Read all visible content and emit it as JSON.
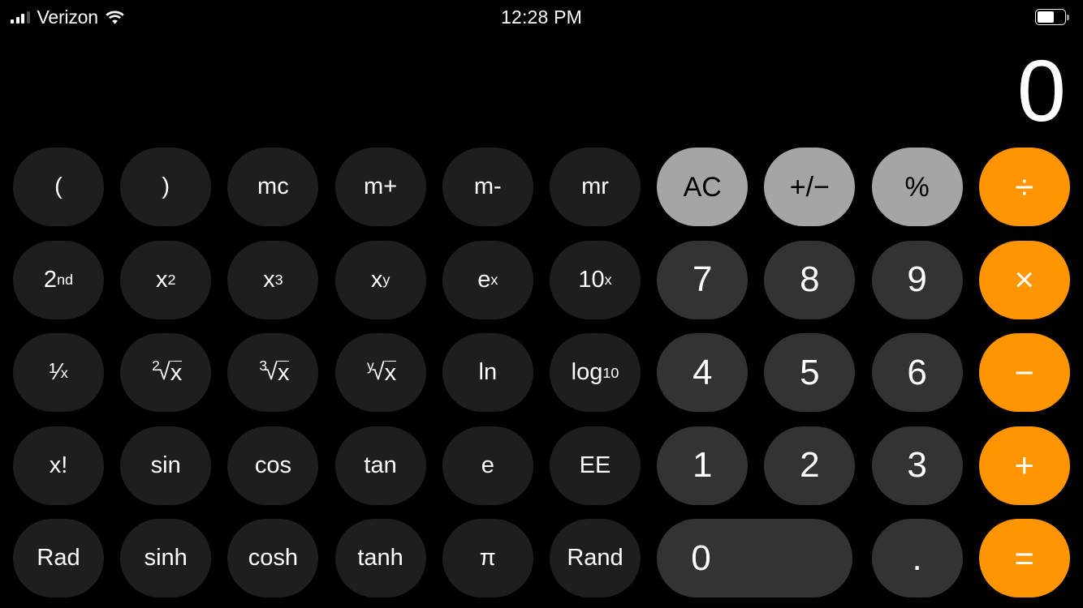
{
  "status_bar": {
    "carrier": "Verizon",
    "signal_icon": "cellular-signal-icon",
    "wifi_icon": "wifi-icon",
    "time": "12:28 PM",
    "battery_icon": "battery-icon",
    "battery_fill_percent": 62
  },
  "display": {
    "value": "0"
  },
  "colors": {
    "background": "#000000",
    "function_key": "#1e1e1e",
    "digit_key": "#333333",
    "utility_key": "#a5a5a5",
    "operator_key": "#ff9500",
    "text_light": "#ffffff",
    "text_dark": "#000000"
  },
  "keypad": {
    "rows": [
      [
        {
          "label": "(",
          "name": "key-open-paren",
          "style": "fn"
        },
        {
          "label": ")",
          "name": "key-close-paren",
          "style": "fn"
        },
        {
          "label": "mc",
          "name": "key-memory-clear",
          "style": "fn"
        },
        {
          "label": "m+",
          "name": "key-memory-add",
          "style": "fn"
        },
        {
          "label": "m-",
          "name": "key-memory-subtract",
          "style": "fn"
        },
        {
          "label": "mr",
          "name": "key-memory-recall",
          "style": "fn"
        },
        {
          "label": "AC",
          "name": "key-all-clear",
          "style": "util"
        },
        {
          "label": "+/−",
          "name": "key-sign-toggle",
          "style": "util"
        },
        {
          "label": "%",
          "name": "key-percent",
          "style": "util"
        },
        {
          "label": "÷",
          "name": "key-divide",
          "style": "op"
        }
      ],
      [
        {
          "label": "2nd",
          "name": "key-second-function",
          "style": "fn",
          "html": "2<sup>nd</sup>"
        },
        {
          "label": "x2",
          "name": "key-x-squared",
          "style": "fn",
          "html": "x<sup>2</sup>"
        },
        {
          "label": "x3",
          "name": "key-x-cubed",
          "style": "fn",
          "html": "x<sup>3</sup>"
        },
        {
          "label": "xy",
          "name": "key-x-power-y",
          "style": "fn",
          "html": "x<sup>y</sup>"
        },
        {
          "label": "ex",
          "name": "key-e-power-x",
          "style": "fn",
          "html": "e<sup>x</sup>"
        },
        {
          "label": "10x",
          "name": "key-ten-power-x",
          "style": "fn",
          "html": "10<sup>x</sup>"
        },
        {
          "label": "7",
          "name": "key-7",
          "style": "digit"
        },
        {
          "label": "8",
          "name": "key-8",
          "style": "digit"
        },
        {
          "label": "9",
          "name": "key-9",
          "style": "digit"
        },
        {
          "label": "×",
          "name": "key-multiply",
          "style": "op"
        }
      ],
      [
        {
          "label": "1/x",
          "name": "key-reciprocal",
          "style": "fn",
          "html": "¹&frasl;<sub>x</sub>"
        },
        {
          "label": "2root x",
          "name": "key-square-root",
          "style": "fn",
          "html": "<span class='rad'><span class='idx'>2</span><span class='sign'>√</span><span style='border-top:1.5px solid #fff'>x</span></span>"
        },
        {
          "label": "3root x",
          "name": "key-cube-root",
          "style": "fn",
          "html": "<span class='rad'><span class='idx'>3</span><span class='sign'>√</span><span style='border-top:1.5px solid #fff'>x</span></span>"
        },
        {
          "label": "yroot x",
          "name": "key-y-root",
          "style": "fn",
          "html": "<span class='rad'><span class='idx'>y</span><span class='sign'>√</span><span style='border-top:1.5px solid #fff'>x</span></span>"
        },
        {
          "label": "ln",
          "name": "key-natural-log",
          "style": "fn"
        },
        {
          "label": "log10",
          "name": "key-log-base-10",
          "style": "fn",
          "html": "log<sub>10</sub>"
        },
        {
          "label": "4",
          "name": "key-4",
          "style": "digit"
        },
        {
          "label": "5",
          "name": "key-5",
          "style": "digit"
        },
        {
          "label": "6",
          "name": "key-6",
          "style": "digit"
        },
        {
          "label": "−",
          "name": "key-subtract",
          "style": "op"
        }
      ],
      [
        {
          "label": "x!",
          "name": "key-factorial",
          "style": "fn"
        },
        {
          "label": "sin",
          "name": "key-sine",
          "style": "fn"
        },
        {
          "label": "cos",
          "name": "key-cosine",
          "style": "fn"
        },
        {
          "label": "tan",
          "name": "key-tangent",
          "style": "fn"
        },
        {
          "label": "e",
          "name": "key-euler-number",
          "style": "fn"
        },
        {
          "label": "EE",
          "name": "key-exponent",
          "style": "fn"
        },
        {
          "label": "1",
          "name": "key-1",
          "style": "digit"
        },
        {
          "label": "2",
          "name": "key-2",
          "style": "digit"
        },
        {
          "label": "3",
          "name": "key-3",
          "style": "digit"
        },
        {
          "label": "+",
          "name": "key-add",
          "style": "op"
        }
      ],
      [
        {
          "label": "Rad",
          "name": "key-radian-mode",
          "style": "fn"
        },
        {
          "label": "sinh",
          "name": "key-hyperbolic-sine",
          "style": "fn"
        },
        {
          "label": "cosh",
          "name": "key-hyperbolic-cosine",
          "style": "fn"
        },
        {
          "label": "tanh",
          "name": "key-hyperbolic-tangent",
          "style": "fn"
        },
        {
          "label": "π",
          "name": "key-pi",
          "style": "fn"
        },
        {
          "label": "Rand",
          "name": "key-random",
          "style": "fn"
        },
        {
          "label": "0",
          "name": "key-0",
          "style": "digit",
          "wide": true
        },
        {
          "label": ".",
          "name": "key-decimal-point",
          "style": "digit"
        },
        {
          "label": "=",
          "name": "key-equals",
          "style": "op"
        }
      ]
    ]
  }
}
